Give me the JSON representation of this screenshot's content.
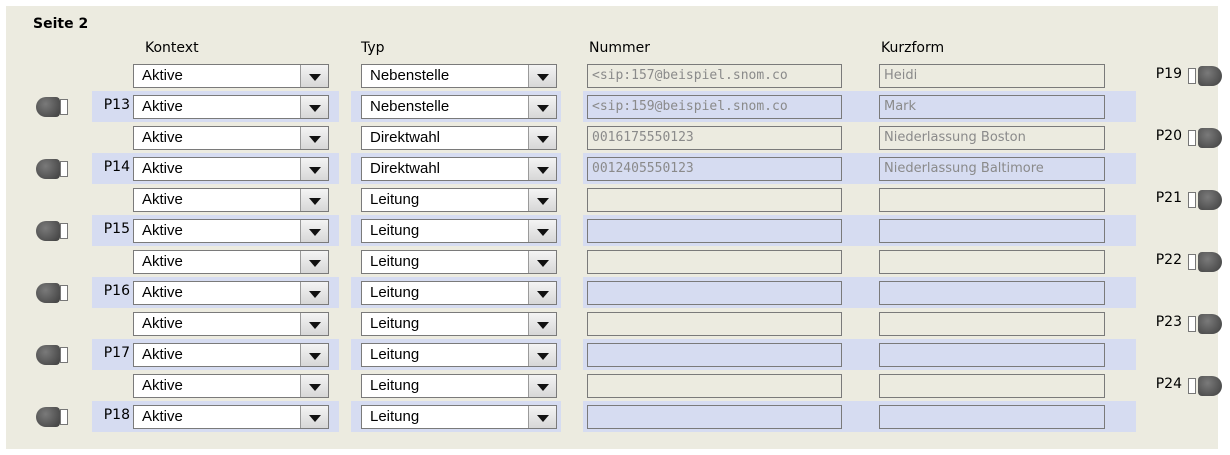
{
  "page_title": "Seite 2",
  "headers": {
    "kontext": "Kontext",
    "typ": "Typ",
    "nummer": "Nummer",
    "kurzform": "Kurzform"
  },
  "rows": [
    {
      "left_label": "",
      "right_label": "P19",
      "kontext": "Aktive",
      "typ": "Nebenstelle",
      "nummer": "<sip:157@beispiel.snom.co",
      "kurzform": "Heidi"
    },
    {
      "left_label": "P13",
      "right_label": "",
      "kontext": "Aktive",
      "typ": "Nebenstelle",
      "nummer": "<sip:159@beispiel.snom.co",
      "kurzform": "Mark"
    },
    {
      "left_label": "",
      "right_label": "P20",
      "kontext": "Aktive",
      "typ": "Direktwahl",
      "nummer": "0016175550123",
      "kurzform": "Niederlassung Boston"
    },
    {
      "left_label": "P14",
      "right_label": "",
      "kontext": "Aktive",
      "typ": "Direktwahl",
      "nummer": "0012405550123",
      "kurzform": "Niederlassung Baltimore"
    },
    {
      "left_label": "",
      "right_label": "P21",
      "kontext": "Aktive",
      "typ": "Leitung",
      "nummer": "",
      "kurzform": ""
    },
    {
      "left_label": "P15",
      "right_label": "",
      "kontext": "Aktive",
      "typ": "Leitung",
      "nummer": "",
      "kurzform": ""
    },
    {
      "left_label": "",
      "right_label": "P22",
      "kontext": "Aktive",
      "typ": "Leitung",
      "nummer": "",
      "kurzform": ""
    },
    {
      "left_label": "P16",
      "right_label": "",
      "kontext": "Aktive",
      "typ": "Leitung",
      "nummer": "",
      "kurzform": ""
    },
    {
      "left_label": "",
      "right_label": "P23",
      "kontext": "Aktive",
      "typ": "Leitung",
      "nummer": "",
      "kurzform": ""
    },
    {
      "left_label": "P17",
      "right_label": "",
      "kontext": "Aktive",
      "typ": "Leitung",
      "nummer": "",
      "kurzform": ""
    },
    {
      "left_label": "",
      "right_label": "P24",
      "kontext": "Aktive",
      "typ": "Leitung",
      "nummer": "",
      "kurzform": ""
    },
    {
      "left_label": "P18",
      "right_label": "",
      "kontext": "Aktive",
      "typ": "Leitung",
      "nummer": "",
      "kurzform": ""
    }
  ]
}
